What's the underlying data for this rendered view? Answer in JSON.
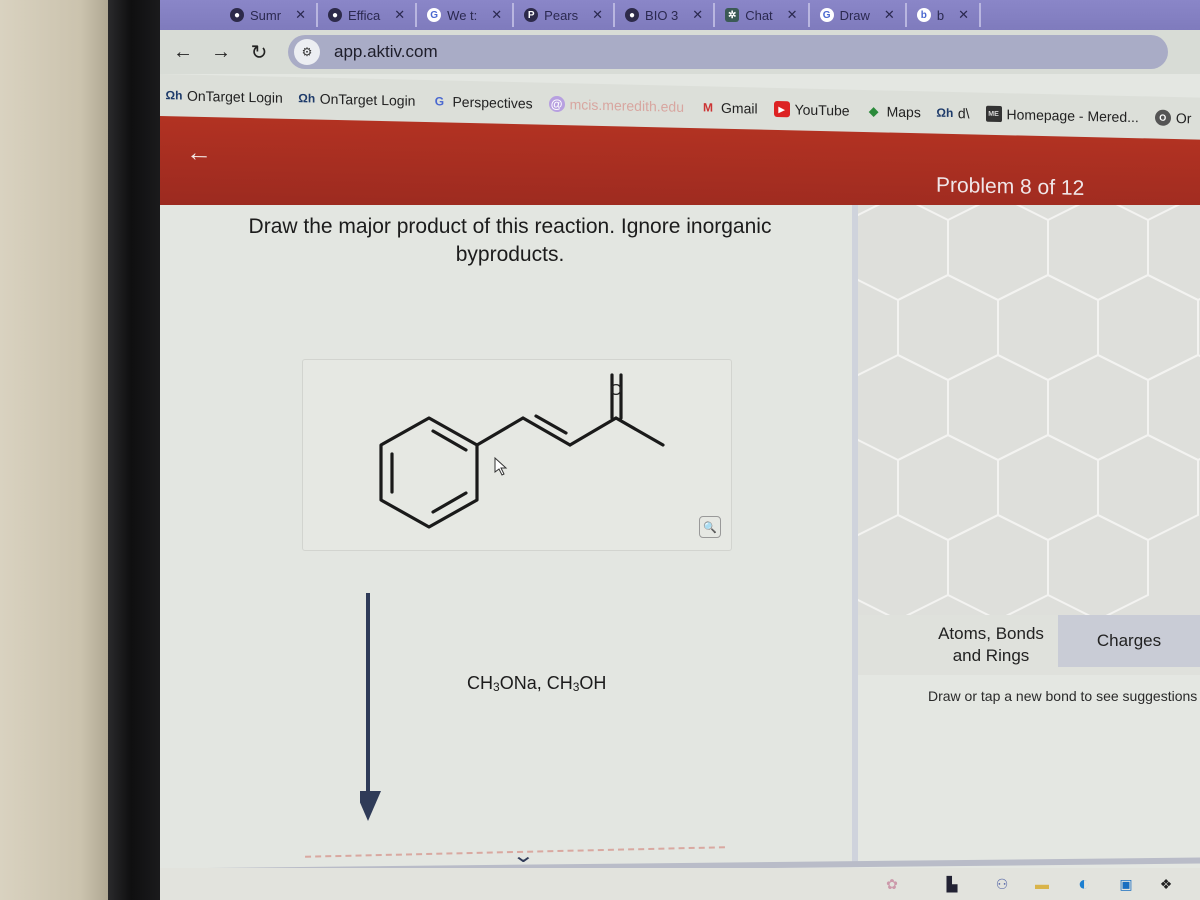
{
  "browser": {
    "tabs": [
      {
        "label": "Sumr",
        "icon": "globe-icon"
      },
      {
        "label": "Effica",
        "icon": "globe-icon"
      },
      {
        "label": "We t:",
        "icon": "google-icon"
      },
      {
        "label": "Pears",
        "icon": "pearson-icon"
      },
      {
        "label": "BIO 3",
        "icon": "globe-icon"
      },
      {
        "label": "Chat",
        "icon": "chatgpt-icon"
      },
      {
        "label": "Draw",
        "icon": "google-icon"
      },
      {
        "label": "b",
        "icon": "bing-icon"
      }
    ],
    "close_glyph": "✕",
    "nav": {
      "back": "←",
      "forward": "→",
      "reload": "↻"
    },
    "url": "app.aktiv.com",
    "bookmarks": [
      {
        "label": "OnTarget Login",
        "icon": "ontarget-icon"
      },
      {
        "label": "OnTarget Login",
        "icon": "ontarget-icon"
      },
      {
        "label": "Perspectives",
        "icon": "google-icon"
      },
      {
        "label": "mcis.meredith.edu",
        "icon": "meredith-icon"
      },
      {
        "label": "Gmail",
        "icon": "gmail-icon"
      },
      {
        "label": "YouTube",
        "icon": "youtube-icon"
      },
      {
        "label": "Maps",
        "icon": "maps-icon"
      },
      {
        "label": "d\\",
        "icon": "ontarget-icon"
      },
      {
        "label": "Homepage - Mered...",
        "icon": "homepage-icon"
      },
      {
        "label": "Or",
        "icon": "other-icon"
      }
    ]
  },
  "app": {
    "back_glyph": "←",
    "problem_label": "Problem 8 of 12",
    "question": "Draw the major product of this reaction. Ignore inorganic byproducts.",
    "reactant": {
      "name": "(E)-4-phenylbut-3-en-2-one",
      "oxygen_label": "O"
    },
    "reagents": [
      {
        "parts": [
          "CH",
          "3",
          "ONa"
        ]
      },
      {
        "parts": [
          "CH",
          "3",
          "OH"
        ]
      }
    ],
    "reagent_separator": ", ",
    "zoom_glyph": "🔍",
    "expand_glyph": "⌄",
    "tools": {
      "atoms_label": "Atoms, Bonds and Rings",
      "charges_label": "Charges",
      "hint": "Draw or tap a new bond to see suggestions"
    }
  },
  "colors": {
    "header_red": "#a52d20",
    "tabstrip": "#857fc2",
    "arrow": "#2f3b58"
  }
}
